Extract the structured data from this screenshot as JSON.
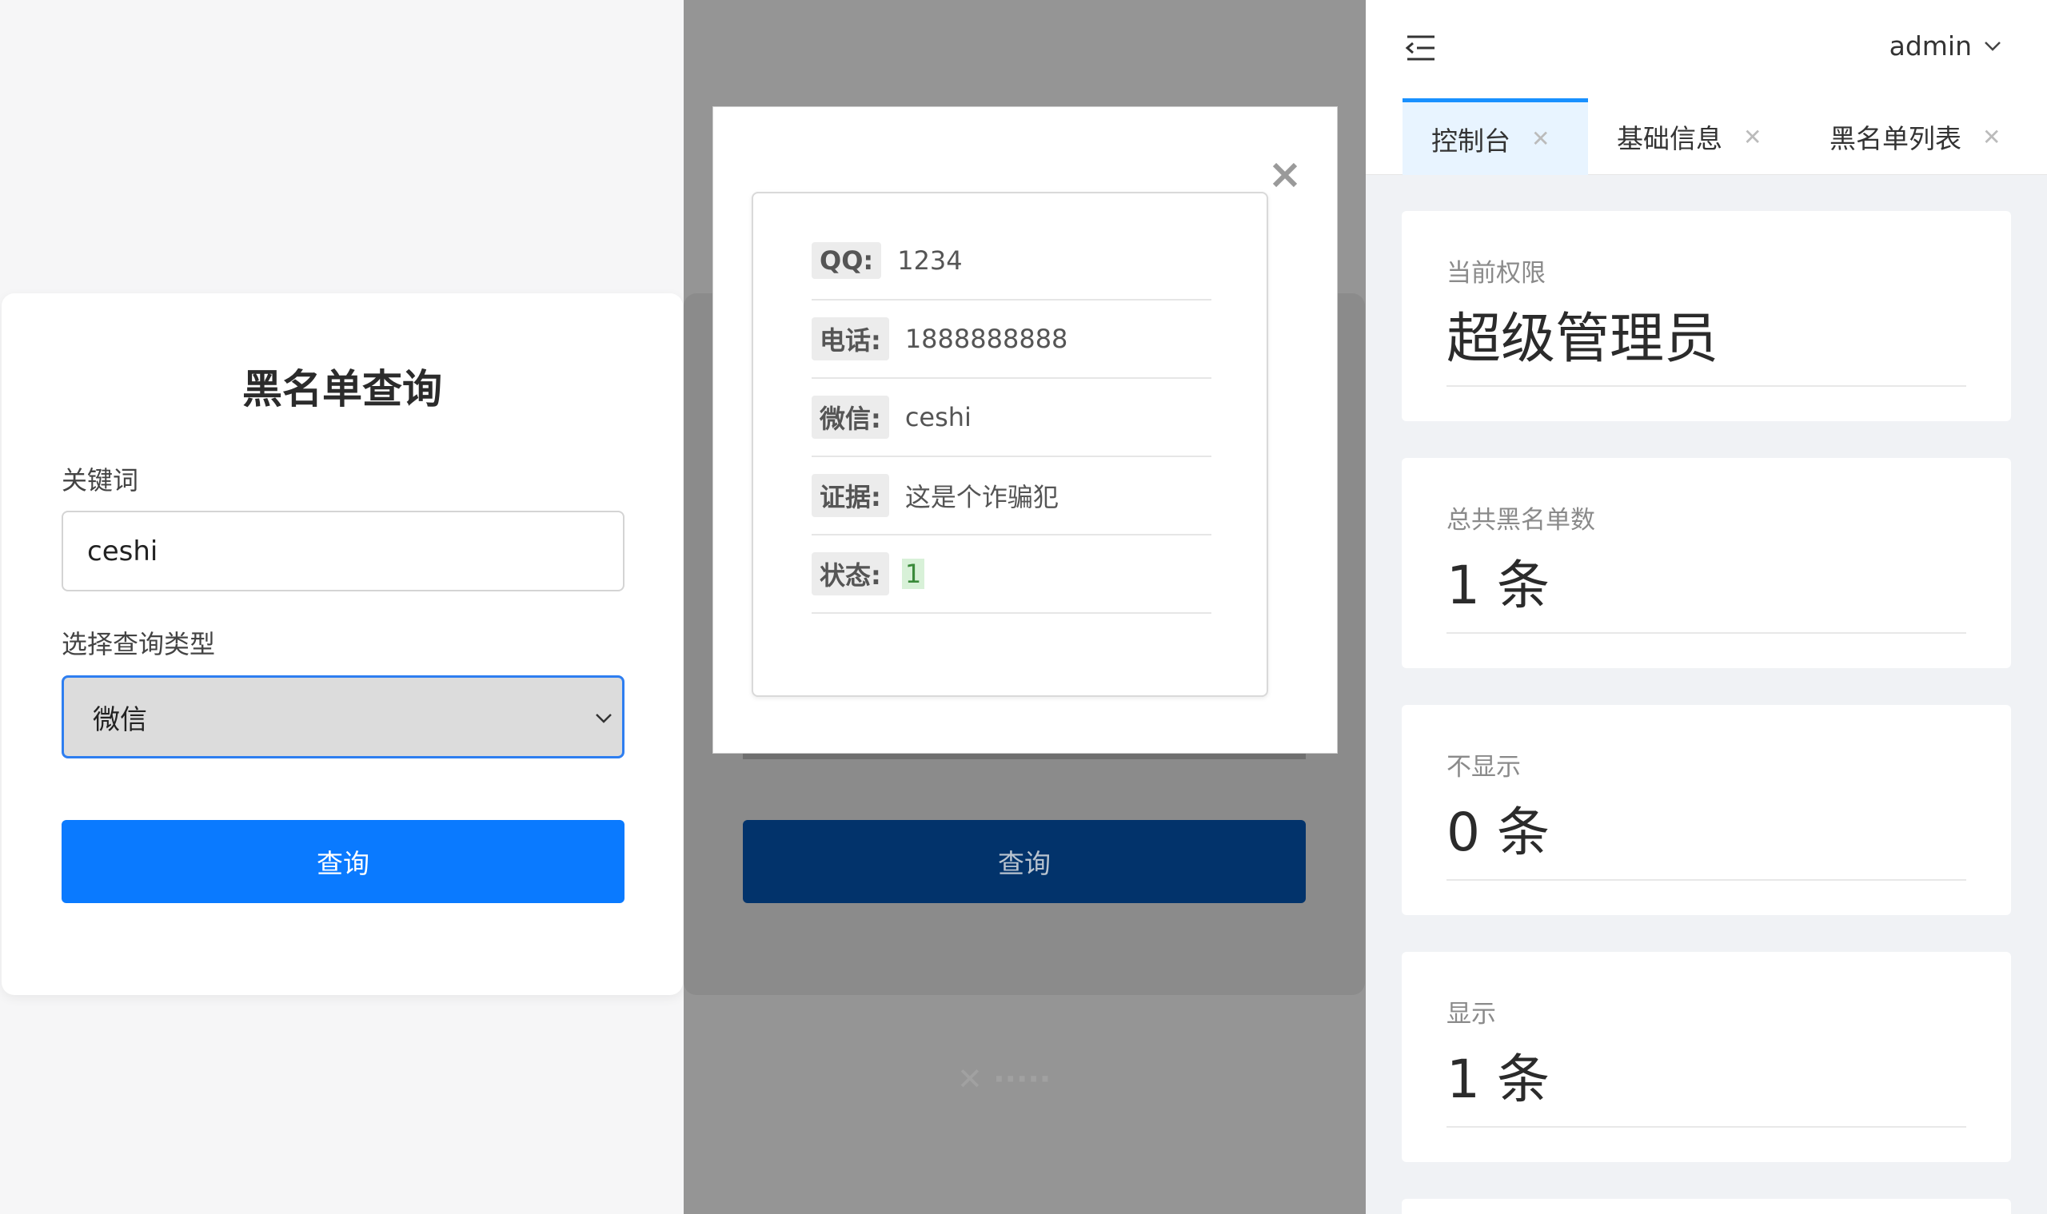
{
  "query_form": {
    "title": "黑名单查询",
    "keyword_label": "关键词",
    "keyword_value": "ceshi",
    "type_label": "选择查询类型",
    "type_value": "微信",
    "submit_label": "查询"
  },
  "result_modal": {
    "submit_label": "查询",
    "rows": [
      {
        "key": "QQ:",
        "value": "1234"
      },
      {
        "key": "电话:",
        "value": "1888888888"
      },
      {
        "key": "微信:",
        "value": "ceshi"
      },
      {
        "key": "证据:",
        "value": "这是个诈骗犯"
      },
      {
        "key": "状态:",
        "value": "1"
      }
    ]
  },
  "dashboard": {
    "user": "admin",
    "tabs": [
      {
        "label": "控制台"
      },
      {
        "label": "基础信息"
      },
      {
        "label": "黑名单列表"
      }
    ],
    "stats": [
      {
        "label": "当前权限",
        "value": "超级管理员"
      },
      {
        "label": "总共黑名单数",
        "value": "1 条"
      },
      {
        "label": "不显示",
        "value": "0 条"
      },
      {
        "label": "显示",
        "value": "1 条"
      }
    ]
  },
  "colors": {
    "primary": "#0a7aff",
    "primary_dim": "#02336b",
    "tab_accent": "#1890ff",
    "status_green": "#d8f1d8"
  }
}
